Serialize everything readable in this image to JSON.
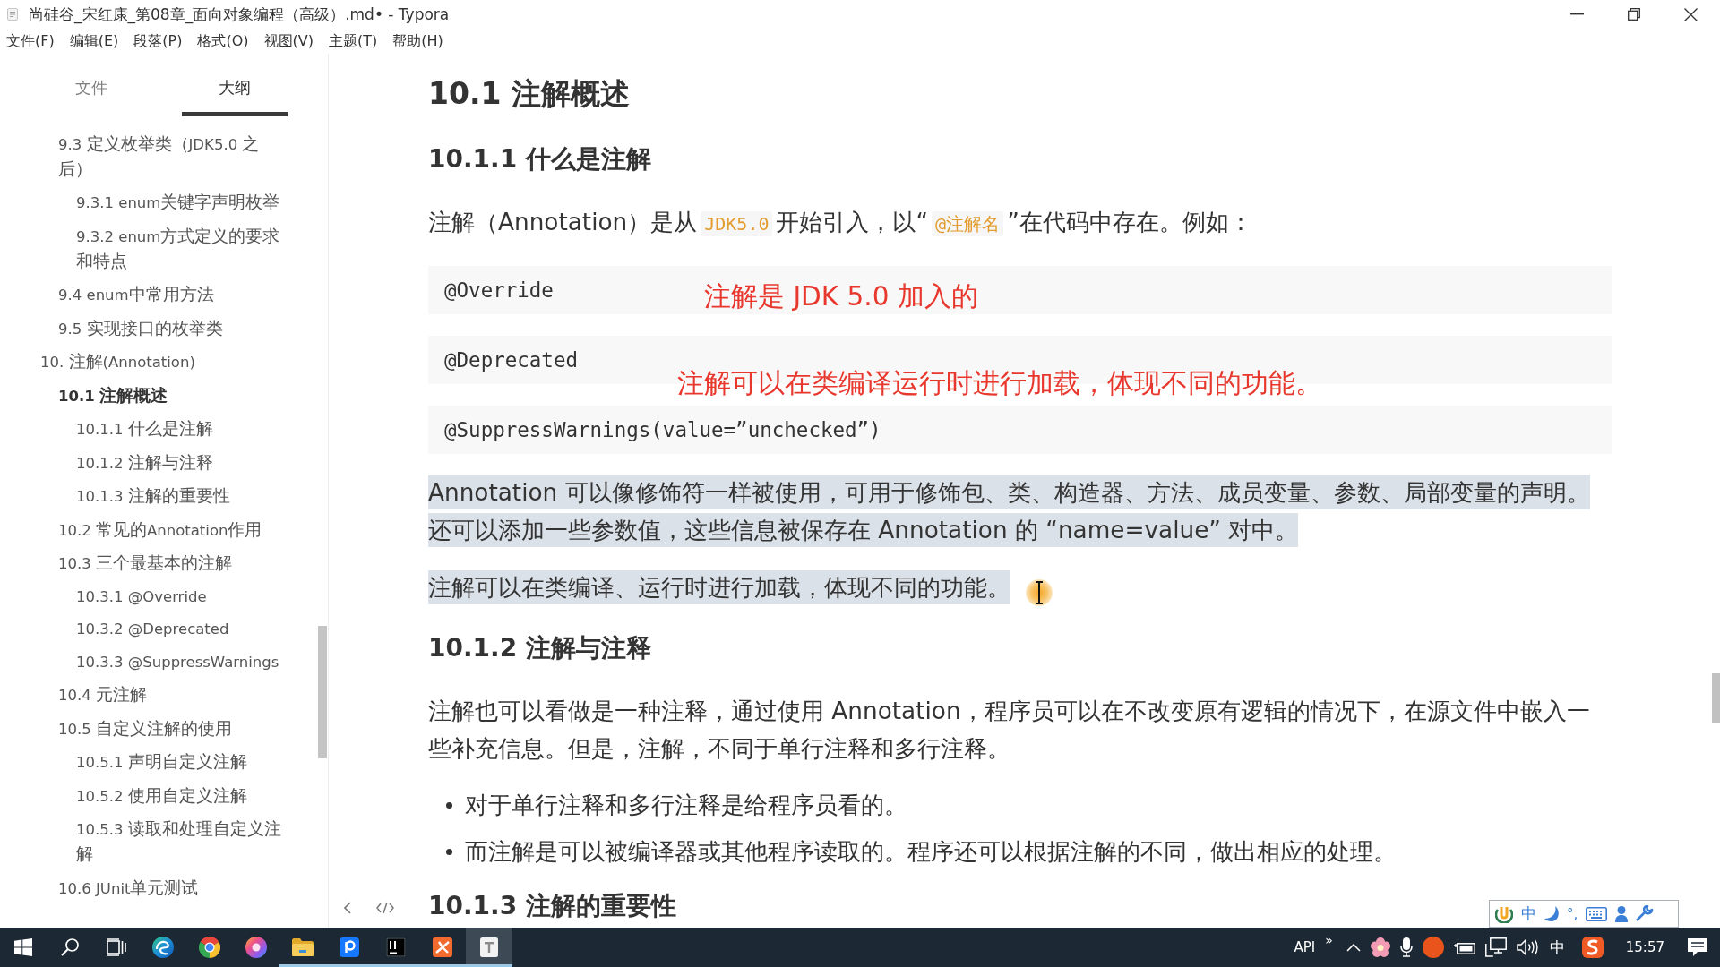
{
  "window": {
    "title": "尚硅谷_宋红康_第08章_面向对象编程（高级）.md• - Typora"
  },
  "menu": [
    {
      "before": "文件(",
      "key": "F",
      "after": ")"
    },
    {
      "before": "编辑(",
      "key": "E",
      "after": ")"
    },
    {
      "before": "段落(",
      "key": "P",
      "after": ")"
    },
    {
      "before": "格式(",
      "key": "O",
      "after": ")"
    },
    {
      "before": "视图(",
      "key": "V",
      "after": ")"
    },
    {
      "before": "主题(",
      "key": "T",
      "after": ")"
    },
    {
      "before": "帮助(",
      "key": "H",
      "after": ")"
    }
  ],
  "sidebar": {
    "tabs": [
      {
        "label": "文件",
        "selected": false
      },
      {
        "label": "大纲",
        "selected": true
      }
    ],
    "outline": [
      {
        "children": [
          {
            "label": "9.3 定义枚举类（JDK5.0 之后）",
            "selected": false,
            "children": [
              {
                "label": "9.3.1 enum关键字声明枚举",
                "selected": false
              },
              {
                "label": "9.3.2 enum方式定义的要求和特点",
                "selected": false
              }
            ]
          },
          {
            "label": "9.4 enum中常用方法",
            "selected": false
          },
          {
            "label": "9.5 实现接口的枚举类",
            "selected": false
          }
        ]
      },
      {
        "label": "10. 注解(Annotation)",
        "selected": false,
        "children": [
          {
            "label": "10.1 注解概述",
            "selected": true,
            "children": [
              {
                "label": "10.1.1 什么是注解",
                "selected": false
              },
              {
                "label": "10.1.2 注解与注释",
                "selected": false
              },
              {
                "label": "10.1.3 注解的重要性",
                "selected": false
              }
            ]
          },
          {
            "label": "10.2 常见的Annotation作用",
            "selected": false
          },
          {
            "label": "10.3 三个最基本的注解",
            "selected": false,
            "children": [
              {
                "label": "10.3.1 @Override",
                "selected": false
              },
              {
                "label": "10.3.2 @Deprecated",
                "selected": false
              },
              {
                "label": "10.3.3 @SuppressWarnings",
                "selected": false
              }
            ]
          },
          {
            "label": "10.4 元注解",
            "selected": false
          },
          {
            "label": "10.5 自定义注解的使用",
            "selected": false,
            "children": [
              {
                "label": "10.5.1 声明自定义注解",
                "selected": false
              },
              {
                "label": "10.5.2 使用自定义注解",
                "selected": false
              },
              {
                "label": "10.5.3 读取和处理自定义注解",
                "selected": false
              }
            ]
          },
          {
            "label": "10.6 JUnit单元测试",
            "selected": false
          }
        ]
      }
    ]
  },
  "document": {
    "blocks": [
      {
        "kind": "heading2",
        "text": "10.1 注解概述",
        "selected": false
      },
      {
        "kind": "heading3",
        "text": "10.1.1 什么是注解",
        "selected": false
      },
      {
        "kind": "paragraph",
        "selected": false,
        "segments": [
          {
            "kind": "text",
            "text": "注解（Annotation）是从"
          },
          {
            "kind": "code",
            "text": "JDK5.0"
          },
          {
            "kind": "text",
            "text": "开始引入，以“"
          },
          {
            "kind": "code",
            "text": "@注解名"
          },
          {
            "kind": "text",
            "text": "”在代码中存在。例如："
          }
        ]
      },
      {
        "kind": "code",
        "text": "@Override",
        "selected": false
      },
      {
        "kind": "code",
        "text": "@Deprecated",
        "selected": false
      },
      {
        "kind": "code",
        "text": "@SuppressWarnings(value=”unchecked”)",
        "selected": false
      },
      {
        "kind": "paragraph",
        "selected": true,
        "segments": [
          {
            "kind": "text",
            "text": "Annotation 可以像修饰符一样被使用，可用于修饰包、类、构造器、方法、成员变量、参数、局部变量的声明。还可以添加一些参数值，这些信息被保存在 Annotation 的 “name=value” 对中。"
          }
        ]
      },
      {
        "kind": "paragraph",
        "selected": true,
        "segments": [
          {
            "kind": "text",
            "text": "注解可以在类编译、运行时进行加载，体现不同的功能。"
          }
        ]
      },
      {
        "kind": "heading3",
        "text": "10.1.2 注解与注释",
        "selected": false
      },
      {
        "kind": "paragraph",
        "selected": false,
        "segments": [
          {
            "kind": "text",
            "text": "注解也可以看做是一种注释，通过使用 Annotation，程序员可以在不改变原有逻辑的情况下，在源文件中嵌入一些补充信息。但是，注解，不同于单行注释和多行注释。"
          }
        ]
      },
      {
        "kind": "list",
        "selected": false,
        "items": [
          {
            "text": "对于单行注释和多行注释是给程序员看的。"
          },
          {
            "text": "而注解是可以被编译器或其他程序读取的。程序还可以根据注解的不同，做出相应的处理。"
          }
        ]
      },
      {
        "kind": "heading3",
        "text": "10.1.3 注解的重要性",
        "selected": false
      }
    ]
  },
  "annotations": [
    {
      "text": "注解是 JDK 5.0 加入的"
    },
    {
      "text": "注解可以在类编译运行时进行加载，体现不同的功能。"
    }
  ],
  "taskbar": {
    "apps": [
      {
        "running": false,
        "active": false
      },
      {
        "running": false,
        "active": false
      },
      {
        "running": false,
        "active": false
      },
      {
        "running": false,
        "active": false
      },
      {
        "running": false,
        "active": false
      },
      {
        "running": false,
        "active": false
      },
      {
        "running": true,
        "active": false
      },
      {
        "running": true,
        "active": false
      },
      {
        "running": true,
        "active": false
      },
      {
        "running": true,
        "active": false
      },
      {
        "running": true,
        "active": true
      }
    ],
    "tray": {
      "label": "API",
      "overflow": "»",
      "language": "中",
      "time": "15:57"
    }
  },
  "ime_toolbar": {
    "mode": "中",
    "punctuation": "°,"
  }
}
